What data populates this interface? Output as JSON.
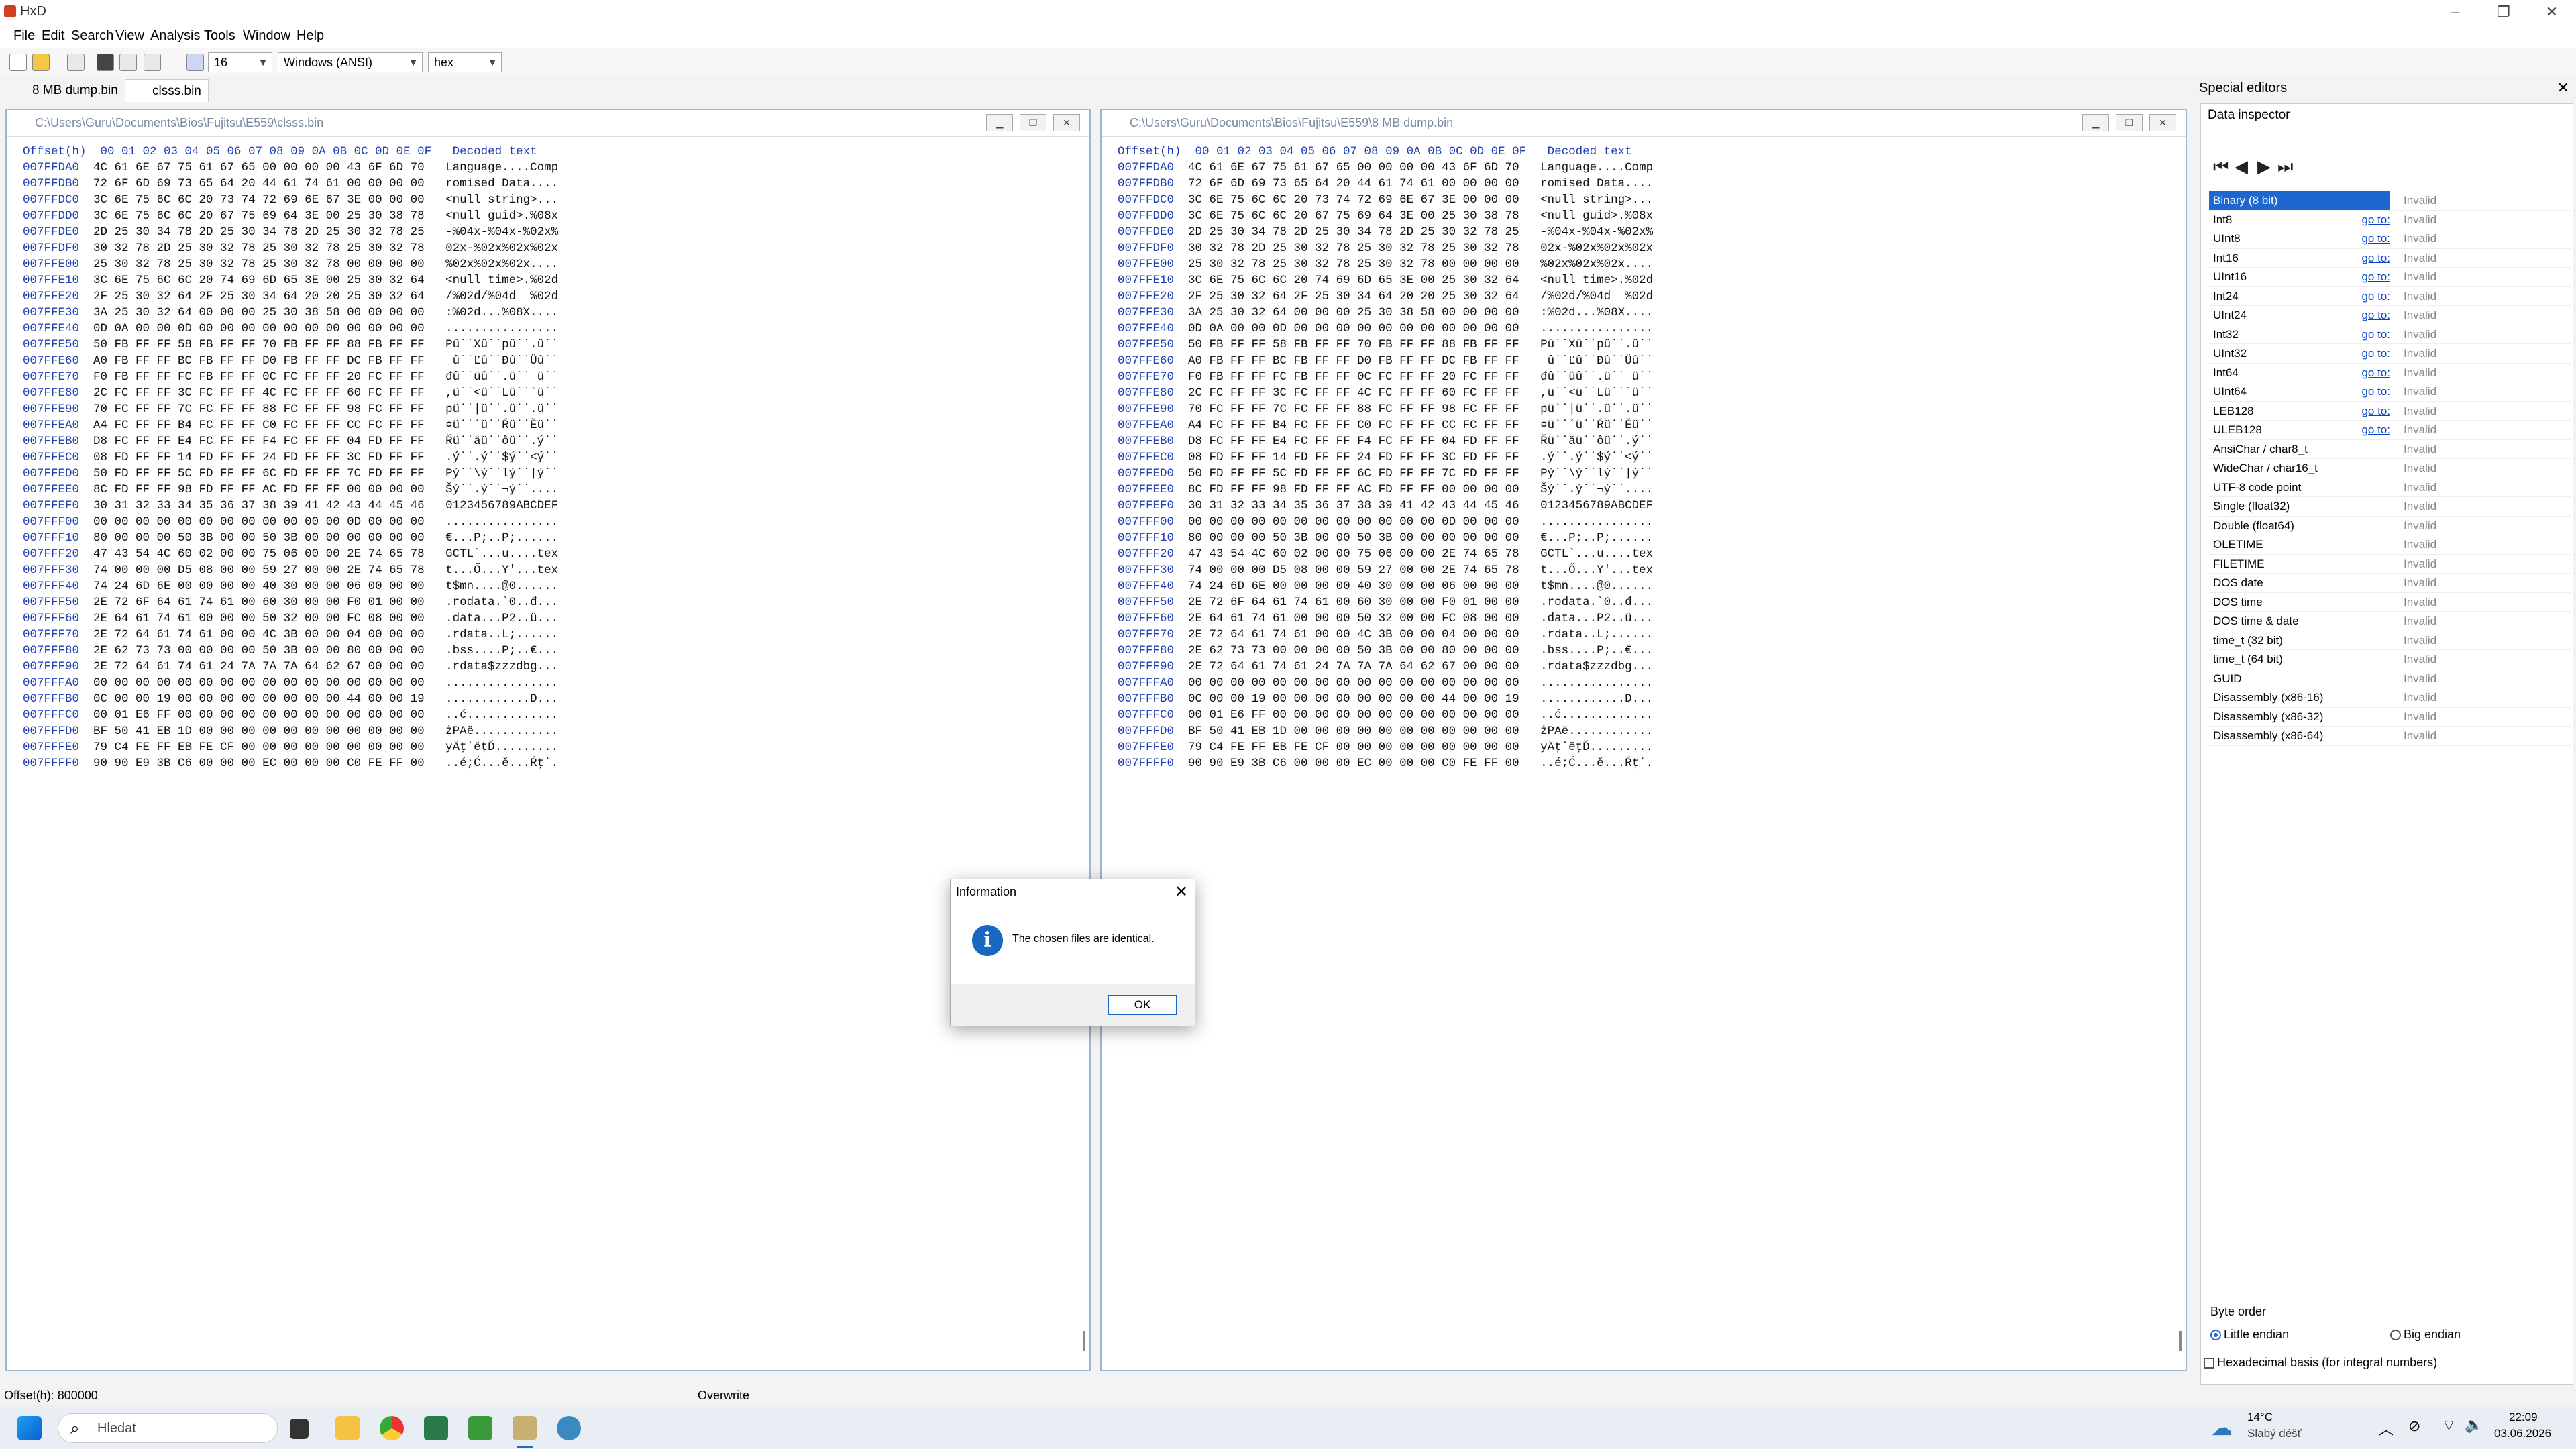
{
  "window": {
    "title": "HxD"
  },
  "menu": [
    "File",
    "Edit",
    "Search",
    "View",
    "Analysis",
    "Tools",
    "Window",
    "Help"
  ],
  "toolbar": {
    "columns": "16",
    "charset": "Windows (ANSI)",
    "mode": "hex"
  },
  "tabs": [
    "8 MB dump.bin",
    "clsss.bin"
  ],
  "header": "Offset(h)  00 01 02 03 04 05 06 07 08 09 0A 0B 0C 0D 0E 0F   Decoded text",
  "left_doc": {
    "path": "C:\\Users\\Guru\\Documents\\Bios\\Fujitsu\\E559\\clsss.bin"
  },
  "right_doc": {
    "path": "C:\\Users\\Guru\\Documents\\Bios\\Fujitsu\\E559\\8 MB dump.bin"
  },
  "rows": [
    [
      "007FFDA0",
      "4C 61 6E 67 75 61 67 65 00 00 00 00 43 6F 6D 70",
      "Language....Comp"
    ],
    [
      "007FFDB0",
      "72 6F 6D 69 73 65 64 20 44 61 74 61 00 00 00 00",
      "romised Data...."
    ],
    [
      "007FFDC0",
      "3C 6E 75 6C 6C 20 73 74 72 69 6E 67 3E 00 00 00",
      "<null string>..."
    ],
    [
      "007FFDD0",
      "3C 6E 75 6C 6C 20 67 75 69 64 3E 00 25 30 38 78",
      "<null guid>.%08x"
    ],
    [
      "007FFDE0",
      "2D 25 30 34 78 2D 25 30 34 78 2D 25 30 32 78 25",
      "-%04x-%04x-%02x%"
    ],
    [
      "007FFDF0",
      "30 32 78 2D 25 30 32 78 25 30 32 78 25 30 32 78",
      "02x-%02x%02x%02x"
    ],
    [
      "007FFE00",
      "25 30 32 78 25 30 32 78 25 30 32 78 00 00 00 00",
      "%02x%02x%02x...."
    ],
    [
      "007FFE10",
      "3C 6E 75 6C 6C 20 74 69 6D 65 3E 00 25 30 32 64",
      "<null time>.%02d"
    ],
    [
      "007FFE20",
      "2F 25 30 32 64 2F 25 30 34 64 20 20 25 30 32 64",
      "/%02d/%04d  %02d"
    ],
    [
      "007FFE30",
      "3A 25 30 32 64 00 00 00 25 30 38 58 00 00 00 00",
      ":%02d...%08X...."
    ],
    [
      "007FFE40",
      "0D 0A 00 00 0D 00 00 00 00 00 00 00 00 00 00 00",
      "................"
    ],
    [
      "007FFE50",
      "50 FB FF FF 58 FB FF FF 70 FB FF FF 88 FB FF FF",
      "Pû˙˙Xû˙˙pû˙˙.û˙˙"
    ],
    [
      "007FFE60",
      "A0 FB FF FF BC FB FF FF D0 FB FF FF DC FB FF FF",
      " û˙˙Ľû˙˙Đû˙˙Üû˙˙"
    ],
    [
      "007FFE70",
      "F0 FB FF FF FC FB FF FF 0C FC FF FF 20 FC FF FF",
      "đû˙˙üû˙˙.ü˙˙ ü˙˙"
    ],
    [
      "007FFE80",
      "2C FC FF FF 3C FC FF FF 4C FC FF FF 60 FC FF FF",
      ",ü˙˙<ü˙˙Lü˙˙`ü˙˙"
    ],
    [
      "007FFE90",
      "70 FC FF FF 7C FC FF FF 88 FC FF FF 98 FC FF FF",
      "pü˙˙|ü˙˙.ü˙˙.ü˙˙"
    ],
    [
      "007FFEA0",
      "A4 FC FF FF B4 FC FF FF C0 FC FF FF CC FC FF FF",
      "¤ü˙˙´ü˙˙Ŕü˙˙Ěü˙˙"
    ],
    [
      "007FFEB0",
      "D8 FC FF FF E4 FC FF FF F4 FC FF FF 04 FD FF FF",
      "Řü˙˙äü˙˙ôü˙˙.ý˙˙"
    ],
    [
      "007FFEC0",
      "08 FD FF FF 14 FD FF FF 24 FD FF FF 3C FD FF FF",
      ".ý˙˙.ý˙˙$ý˙˙<ý˙˙"
    ],
    [
      "007FFED0",
      "50 FD FF FF 5C FD FF FF 6C FD FF FF 7C FD FF FF",
      "Pý˙˙\\ý˙˙lý˙˙|ý˙˙"
    ],
    [
      "007FFEE0",
      "8C FD FF FF 98 FD FF FF AC FD FF FF 00 00 00 00",
      "Šý˙˙.ý˙˙¬ý˙˙...."
    ],
    [
      "007FFEF0",
      "30 31 32 33 34 35 36 37 38 39 41 42 43 44 45 46",
      "0123456789ABCDEF"
    ],
    [
      "007FFF00",
      "00 00 00 00 00 00 00 00 00 00 00 00 0D 00 00 00",
      "................"
    ],
    [
      "007FFF10",
      "80 00 00 00 50 3B 00 00 50 3B 00 00 00 00 00 00",
      "€...P;..P;......"
    ],
    [
      "007FFF20",
      "47 43 54 4C 60 02 00 00 75 06 00 00 2E 74 65 78",
      "GCTL`...u....tex"
    ],
    [
      "007FFF30",
      "74 00 00 00 D5 08 00 00 59 27 00 00 2E 74 65 78",
      "t...Ő...Y'...tex"
    ],
    [
      "007FFF40",
      "74 24 6D 6E 00 00 00 00 40 30 00 00 06 00 00 00",
      "t$mn....@0......"
    ],
    [
      "007FFF50",
      "2E 72 6F 64 61 74 61 00 60 30 00 00 F0 01 00 00",
      ".rodata.`0..đ..."
    ],
    [
      "007FFF60",
      "2E 64 61 74 61 00 00 00 50 32 00 00 FC 08 00 00",
      ".data...P2..ü..."
    ],
    [
      "007FFF70",
      "2E 72 64 61 74 61 00 00 4C 3B 00 00 04 00 00 00",
      ".rdata..L;......"
    ],
    [
      "007FFF80",
      "2E 62 73 73 00 00 00 00 50 3B 00 00 80 00 00 00",
      ".bss....P;..€..."
    ],
    [
      "007FFF90",
      "2E 72 64 61 74 61 24 7A 7A 7A 64 62 67 00 00 00",
      ".rdata$zzzdbg..."
    ],
    [
      "007FFFA0",
      "00 00 00 00 00 00 00 00 00 00 00 00 00 00 00 00",
      "................"
    ],
    [
      "007FFFB0",
      "0C 00 00 19 00 00 00 00 00 00 00 00 44 00 00 19",
      "............D..."
    ],
    [
      "007FFFC0",
      "00 01 E6 FF 00 00 00 00 00 00 00 00 00 00 00 00",
      "..ć............."
    ],
    [
      "007FFFD0",
      "BF 50 41 EB 1D 00 00 00 00 00 00 00 00 00 00 00",
      "żPAë............"
    ],
    [
      "007FFFE0",
      "79 C4 FE FF EB FE CF 00 00 00 00 00 00 00 00 00",
      "yÄţ˙ëţĎ........."
    ],
    [
      "007FFFF0",
      "90 90 E9 3B C6 00 00 00 EC 00 00 00 C0 FE FF 00",
      "..é;Ć...ě...Ŕţ˙."
    ]
  ],
  "special": {
    "title": "Special editors",
    "tab": "Data inspector"
  },
  "inspector": [
    [
      "Binary (8 bit)",
      "",
      "Invalid"
    ],
    [
      "Int8",
      "go to:",
      "Invalid"
    ],
    [
      "UInt8",
      "go to:",
      "Invalid"
    ],
    [
      "Int16",
      "go to:",
      "Invalid"
    ],
    [
      "UInt16",
      "go to:",
      "Invalid"
    ],
    [
      "Int24",
      "go to:",
      "Invalid"
    ],
    [
      "UInt24",
      "go to:",
      "Invalid"
    ],
    [
      "Int32",
      "go to:",
      "Invalid"
    ],
    [
      "UInt32",
      "go to:",
      "Invalid"
    ],
    [
      "Int64",
      "go to:",
      "Invalid"
    ],
    [
      "UInt64",
      "go to:",
      "Invalid"
    ],
    [
      "LEB128",
      "go to:",
      "Invalid"
    ],
    [
      "ULEB128",
      "go to:",
      "Invalid"
    ],
    [
      "AnsiChar / char8_t",
      "",
      "Invalid"
    ],
    [
      "WideChar / char16_t",
      "",
      "Invalid"
    ],
    [
      "UTF-8 code point",
      "",
      "Invalid"
    ],
    [
      "Single (float32)",
      "",
      "Invalid"
    ],
    [
      "Double (float64)",
      "",
      "Invalid"
    ],
    [
      "OLETIME",
      "",
      "Invalid"
    ],
    [
      "FILETIME",
      "",
      "Invalid"
    ],
    [
      "DOS date",
      "",
      "Invalid"
    ],
    [
      "DOS time",
      "",
      "Invalid"
    ],
    [
      "DOS time & date",
      "",
      "Invalid"
    ],
    [
      "time_t (32 bit)",
      "",
      "Invalid"
    ],
    [
      "time_t (64 bit)",
      "",
      "Invalid"
    ],
    [
      "GUID",
      "",
      "Invalid"
    ],
    [
      "Disassembly (x86-16)",
      "",
      "Invalid"
    ],
    [
      "Disassembly (x86-32)",
      "",
      "Invalid"
    ],
    [
      "Disassembly (x86-64)",
      "",
      "Invalid"
    ]
  ],
  "byte_order": {
    "label": "Byte order",
    "little": "Little endian",
    "big": "Big endian",
    "hexbasis": "Hexadecimal basis (for integral numbers)"
  },
  "status": {
    "offset": "Offset(h): 800000",
    "mode": "Overwrite"
  },
  "dialog": {
    "title": "Information",
    "message": "The chosen files are identical.",
    "ok": "OK"
  },
  "taskbar": {
    "search": "Hledat",
    "weather_temp": "14°C",
    "weather_desc": "Slabý déšť",
    "time": "22:09",
    "date": "03.06.2026"
  },
  "colors": {
    "accent": "#1e66d0",
    "offset": "#1f3fb3"
  }
}
